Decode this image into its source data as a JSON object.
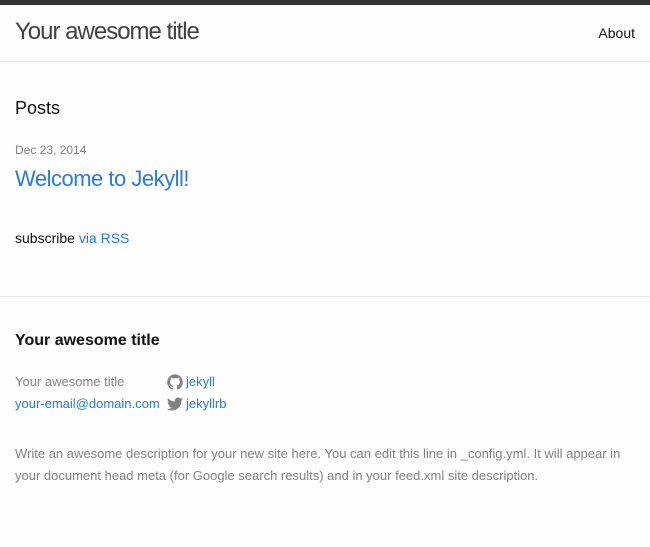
{
  "header": {
    "site_title": "Your awesome title",
    "nav_about": "About"
  },
  "main": {
    "heading": "Posts",
    "posts": [
      {
        "date": "Dec 23, 2014",
        "title": "Welcome to Jekyll!"
      }
    ],
    "rss": {
      "prefix": "subscribe",
      "link": "via RSS"
    }
  },
  "footer": {
    "heading": "Your awesome title",
    "name": "Your awesome title",
    "email": "your-email@domain.com",
    "github_username": "jekyll",
    "twitter_username": "jekyllrb",
    "description": "Write an awesome description for your new site here. You can edit this line in _config.yml. It will appear in your document head meta (for Google search results) and in your feed.xml site description."
  },
  "colors": {
    "link": "#2a7ae2",
    "muted": "#828282",
    "header_border": "#333333",
    "divider": "#e8e8e8",
    "background": "#fdfdfd",
    "icon": "#828282"
  },
  "icons": {
    "github": "github-icon",
    "twitter": "twitter-icon"
  }
}
